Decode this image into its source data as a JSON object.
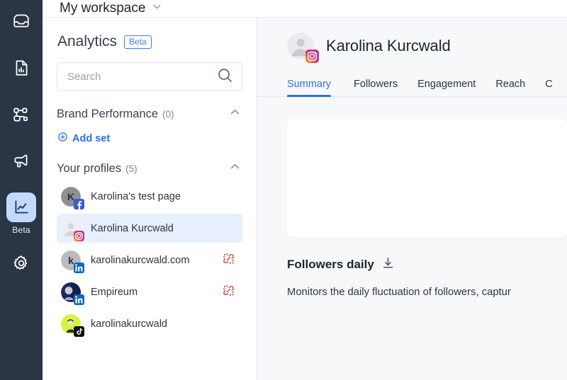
{
  "rail": {
    "items": [
      {
        "name": "inbox-icon",
        "label": "Inbox"
      },
      {
        "name": "reports-icon",
        "label": "Reports"
      },
      {
        "name": "workflow-icon",
        "label": "Workflow"
      },
      {
        "name": "megaphone-icon",
        "label": "Campaigns"
      }
    ],
    "active": {
      "name": "analytics-chart-icon",
      "label": "Beta"
    },
    "settings": {
      "name": "gear-icon",
      "label": "Settings"
    }
  },
  "topbar": {
    "workspace_title": "My workspace",
    "chevron": "chevron-down-icon"
  },
  "sidebar": {
    "title": "Analytics",
    "beta_badge": "Beta",
    "search": {
      "value": "",
      "placeholder": "Search"
    },
    "brand_performance": {
      "title": "Brand Performance",
      "count": "(0)",
      "add_set_label": "Add set"
    },
    "your_profiles": {
      "title": "Your profiles",
      "count": "(5)"
    },
    "profiles": [
      {
        "name": "Karolina's test page",
        "network": "facebook",
        "selected": false,
        "disconnected": false,
        "avatar_kind": "letter",
        "avatar_letter": "K",
        "avatar_bg": "#8d8f93"
      },
      {
        "name": "Karolina Kurcwald",
        "network": "instagram",
        "selected": true,
        "disconnected": false,
        "avatar_kind": "silhouette",
        "avatar_letter": "",
        "avatar_bg": "#e9ebee"
      },
      {
        "name": "karolinakurcwald.com",
        "network": "linkedin",
        "selected": false,
        "disconnected": true,
        "avatar_kind": "letter",
        "avatar_letter": "k",
        "avatar_bg": "#b9bbbe"
      },
      {
        "name": "Empireum",
        "network": "linkedin",
        "selected": false,
        "disconnected": true,
        "avatar_kind": "photo-dark",
        "avatar_letter": "",
        "avatar_bg": "#1d2a5c"
      },
      {
        "name": "karolinakurcwald",
        "network": "tiktok",
        "selected": false,
        "disconnected": false,
        "avatar_kind": "photo-lime",
        "avatar_letter": "",
        "avatar_bg": "#d7f23f"
      }
    ]
  },
  "main": {
    "profile": {
      "name": "Karolina Kurcwald",
      "network": "instagram"
    },
    "tabs": [
      {
        "label": "Summary",
        "active": true
      },
      {
        "label": "Followers",
        "active": false
      },
      {
        "label": "Engagement",
        "active": false
      },
      {
        "label": "Reach",
        "active": false
      },
      {
        "label": "C",
        "active": false
      }
    ],
    "followers_daily": {
      "title": "Followers daily",
      "download_icon": "download-icon",
      "description": "Monitors the daily fluctuation of followers, captur"
    }
  },
  "colors": {
    "rail_bg": "#2b3645",
    "accent": "#2f6fe4",
    "selected_row": "#e7f0fc",
    "disconnected": "#cf3b37",
    "main_bg": "#f7f8fa"
  }
}
